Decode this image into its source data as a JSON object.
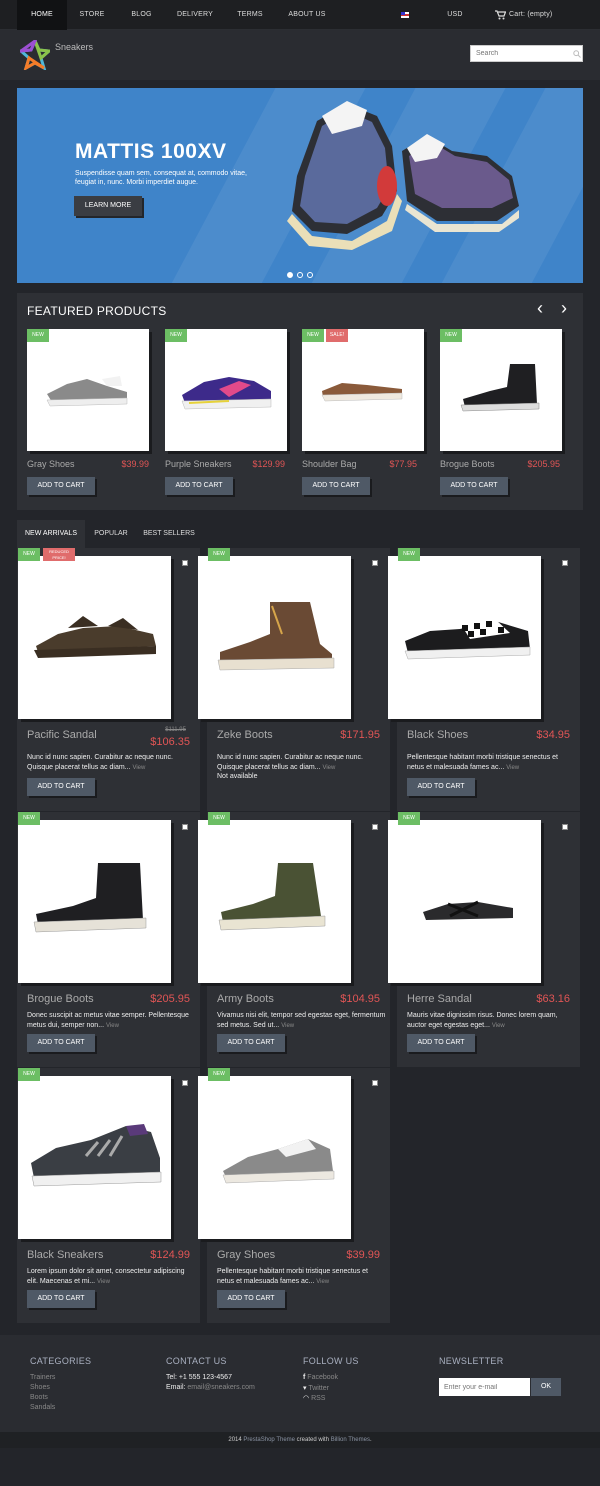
{
  "nav": {
    "items": [
      "HOME",
      "STORE",
      "BLOG",
      "DELIVERY",
      "TERMS",
      "ABOUT US"
    ],
    "currency": "USD",
    "cart": "Cart: (empty)"
  },
  "header": {
    "logo_text": "Sneakers",
    "search_placeholder": "Search"
  },
  "slider": {
    "title": "MATTIS 100XV",
    "description": "Suspendisse quam sem, consequat at, commodo vitae, feugiat in, nunc. Morbi imperdiet augue.",
    "button": "LEARN MORE",
    "active_slide": 1,
    "slide_count": 3
  },
  "featured": {
    "title": "FEATURED PRODUCTS",
    "prev": "‹",
    "next": "›",
    "products": [
      {
        "name": "Gray Shoes",
        "price": "$39.99",
        "badges": [
          "NEW"
        ]
      },
      {
        "name": "Purple Sneakers",
        "price": "$129.99",
        "badges": [
          "NEW"
        ]
      },
      {
        "name": "Shoulder Bag",
        "price": "$77.95",
        "badges": [
          "NEW",
          "SALE!"
        ]
      },
      {
        "name": "Brogue Boots",
        "price": "$205.95",
        "badges": [
          "NEW"
        ]
      }
    ],
    "add_to_cart": "ADD TO CART"
  },
  "tabs": [
    "NEW ARRIVALS",
    "POPULAR",
    "BEST SELLERS"
  ],
  "products": [
    {
      "name": "Pacific Sandal",
      "price": "$106.35",
      "old_price": "$111.95",
      "badges": [
        "NEW",
        "REDUCED PRICE!"
      ],
      "desc": "Nunc id nunc sapien. Curabitur ac neque nunc. Quisque placerat tellus ac diam...",
      "view": "View",
      "availability": ""
    },
    {
      "name": "Zeke Boots",
      "price": "$171.95",
      "old_price": "",
      "badges": [
        "NEW"
      ],
      "desc": "Nunc id nunc sapien. Curabitur ac neque nunc. Quisque placerat tellus ac diam...",
      "view": "View",
      "availability": "Not available"
    },
    {
      "name": "Black Shoes",
      "price": "$34.95",
      "old_price": "",
      "badges": [
        "NEW"
      ],
      "desc": "Pellentesque habitant morbi tristique senectus et netus et malesuada fames ac...",
      "view": "View",
      "availability": ""
    },
    {
      "name": "Brogue Boots",
      "price": "$205.95",
      "old_price": "",
      "badges": [
        "NEW"
      ],
      "desc": "Donec suscipit ac metus vitae semper. Pellentesque metus dui, semper non...",
      "view": "View",
      "availability": ""
    },
    {
      "name": "Army Boots",
      "price": "$104.95",
      "old_price": "",
      "badges": [
        "NEW"
      ],
      "desc": "Vivamus nisi elit, tempor sed egestas eget, fermentum sed metus. Sed ut...",
      "view": "View",
      "availability": ""
    },
    {
      "name": "Herre Sandal",
      "price": "$63.16",
      "old_price": "",
      "badges": [
        "NEW"
      ],
      "desc": "Mauris vitae dignissim risus. Donec lorem quam, auctor eget egestas eget...",
      "view": "View",
      "availability": ""
    },
    {
      "name": "Black Sneakers",
      "price": "$124.99",
      "old_price": "",
      "badges": [
        "NEW"
      ],
      "desc": "Lorem ipsum dolor sit amet, consectetur adipiscing elit. Maecenas et mi...",
      "view": "View",
      "availability": ""
    },
    {
      "name": "Gray Shoes",
      "price": "$39.99",
      "old_price": "",
      "badges": [
        "NEW"
      ],
      "desc": "Pellentesque habitant morbi tristique senectus et netus et malesuada fames ac...",
      "view": "View",
      "availability": ""
    }
  ],
  "add_to_cart": "ADD TO CART",
  "footer": {
    "categories_title": "CATEGORIES",
    "categories": [
      "Trainers",
      "Shoes",
      "Boots",
      "Sandals"
    ],
    "contact_title": "CONTACT US",
    "tel": "Tel: +1 555 123-4567",
    "email_label": "Email:",
    "email": "email@sneakers.com",
    "follow_title": "FOLLOW US",
    "follow": [
      "Facebook",
      "Twitter",
      "RSS"
    ],
    "newsletter_title": "NEWSLETTER",
    "newsletter_placeholder": "Enter your e-mail",
    "newsletter_button": "OK",
    "copyright_year": "2014",
    "copyright_theme": "PrestaShop Theme",
    "copyright_mid": "created with",
    "copyright_author": "Billion Themes",
    "copyright_end": "."
  },
  "colors": {
    "accent_price": "#e05555",
    "badge_new": "#6cbe64",
    "badge_sale": "#e06c6c",
    "hero": "#3f84c9",
    "button": "#4f5966"
  }
}
